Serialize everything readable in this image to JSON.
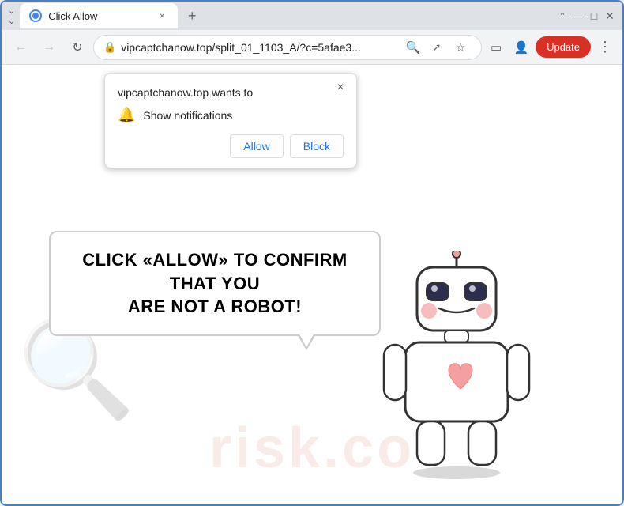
{
  "window": {
    "title": "Click Allow",
    "tab_close_label": "×",
    "new_tab_label": "+"
  },
  "window_controls": {
    "minimize": "—",
    "maximize": "□",
    "close": "✕",
    "chevron_up": "⌃"
  },
  "address_bar": {
    "url": "vipcaptchanow.top/split_01_1103_A/?c=5afae3...",
    "lock_icon": "🔒"
  },
  "toolbar": {
    "update_label": "Update",
    "menu_dots": "⋮",
    "back_arrow": "←",
    "forward_arrow": "→",
    "reload": "↻",
    "search_icon": "🔍",
    "share_icon": "↗",
    "bookmark_icon": "☆",
    "tablet_icon": "▭",
    "profile_icon": "👤"
  },
  "notification_popup": {
    "title": "vipcaptchanow.top wants to",
    "permission": "Show notifications",
    "allow_label": "Allow",
    "block_label": "Block",
    "close_label": "×"
  },
  "page": {
    "cta_line1": "CLICK «ALLOW» TO CONFIRM THAT YOU",
    "cta_line2": "ARE NOT A ROBOT!",
    "watermark": "risk.co"
  }
}
